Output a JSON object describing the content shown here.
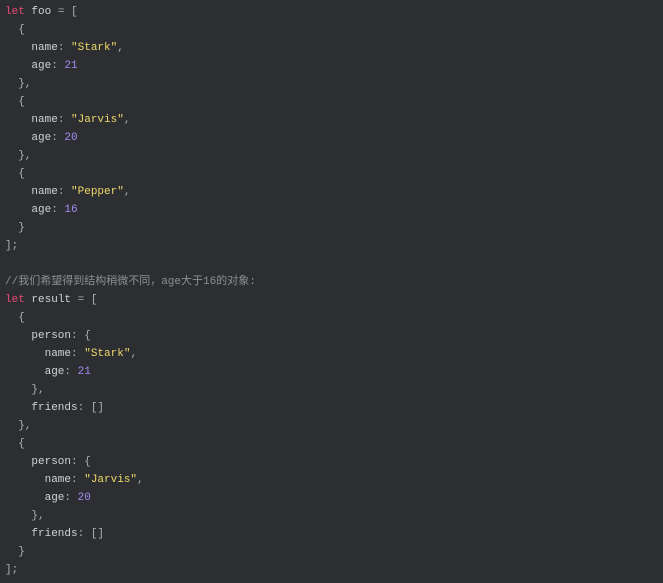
{
  "colors": {
    "background": "#2c2e32",
    "keyword": "#e8476f",
    "string": "#efd86a",
    "number": "#a78bf3",
    "comment": "#8d8f92",
    "text": "#d0d2d4"
  },
  "lines": [
    [
      [
        "kw",
        "let"
      ],
      [
        "id",
        " foo "
      ],
      [
        "pun",
        "= ["
      ]
    ],
    [
      [
        "pun",
        "  {"
      ]
    ],
    [
      [
        "id",
        "    name"
      ],
      [
        "pun",
        ": "
      ],
      [
        "str",
        "\"Stark\""
      ],
      [
        "pun",
        ","
      ]
    ],
    [
      [
        "id",
        "    age"
      ],
      [
        "pun",
        ": "
      ],
      [
        "num",
        "21"
      ]
    ],
    [
      [
        "pun",
        "  },"
      ]
    ],
    [
      [
        "pun",
        "  {"
      ]
    ],
    [
      [
        "id",
        "    name"
      ],
      [
        "pun",
        ": "
      ],
      [
        "str",
        "\"Jarvis\""
      ],
      [
        "pun",
        ","
      ]
    ],
    [
      [
        "id",
        "    age"
      ],
      [
        "pun",
        ": "
      ],
      [
        "num",
        "20"
      ]
    ],
    [
      [
        "pun",
        "  },"
      ]
    ],
    [
      [
        "pun",
        "  {"
      ]
    ],
    [
      [
        "id",
        "    name"
      ],
      [
        "pun",
        ": "
      ],
      [
        "str",
        "\"Pepper\""
      ],
      [
        "pun",
        ","
      ]
    ],
    [
      [
        "id",
        "    age"
      ],
      [
        "pun",
        ": "
      ],
      [
        "num",
        "16"
      ]
    ],
    [
      [
        "pun",
        "  }"
      ]
    ],
    [
      [
        "pun",
        "];"
      ]
    ],
    [],
    [
      [
        "cm",
        "//我们希望得到结构稍微不同，age大于16的对象:"
      ]
    ],
    [
      [
        "kw",
        "let"
      ],
      [
        "id",
        " result "
      ],
      [
        "pun",
        "= ["
      ]
    ],
    [
      [
        "pun",
        "  {"
      ]
    ],
    [
      [
        "id",
        "    person"
      ],
      [
        "pun",
        ": {"
      ]
    ],
    [
      [
        "id",
        "      name"
      ],
      [
        "pun",
        ": "
      ],
      [
        "str",
        "\"Stark\""
      ],
      [
        "pun",
        ","
      ]
    ],
    [
      [
        "id",
        "      age"
      ],
      [
        "pun",
        ": "
      ],
      [
        "num",
        "21"
      ]
    ],
    [
      [
        "pun",
        "    },"
      ]
    ],
    [
      [
        "id",
        "    friends"
      ],
      [
        "pun",
        ": []"
      ]
    ],
    [
      [
        "pun",
        "  },"
      ]
    ],
    [
      [
        "pun",
        "  {"
      ]
    ],
    [
      [
        "id",
        "    person"
      ],
      [
        "pun",
        ": {"
      ]
    ],
    [
      [
        "id",
        "      name"
      ],
      [
        "pun",
        ": "
      ],
      [
        "str",
        "\"Jarvis\""
      ],
      [
        "pun",
        ","
      ]
    ],
    [
      [
        "id",
        "      age"
      ],
      [
        "pun",
        ": "
      ],
      [
        "num",
        "20"
      ]
    ],
    [
      [
        "pun",
        "    },"
      ]
    ],
    [
      [
        "id",
        "    friends"
      ],
      [
        "pun",
        ": []"
      ]
    ],
    [
      [
        "pun",
        "  }"
      ]
    ],
    [
      [
        "pun",
        "];"
      ]
    ]
  ]
}
